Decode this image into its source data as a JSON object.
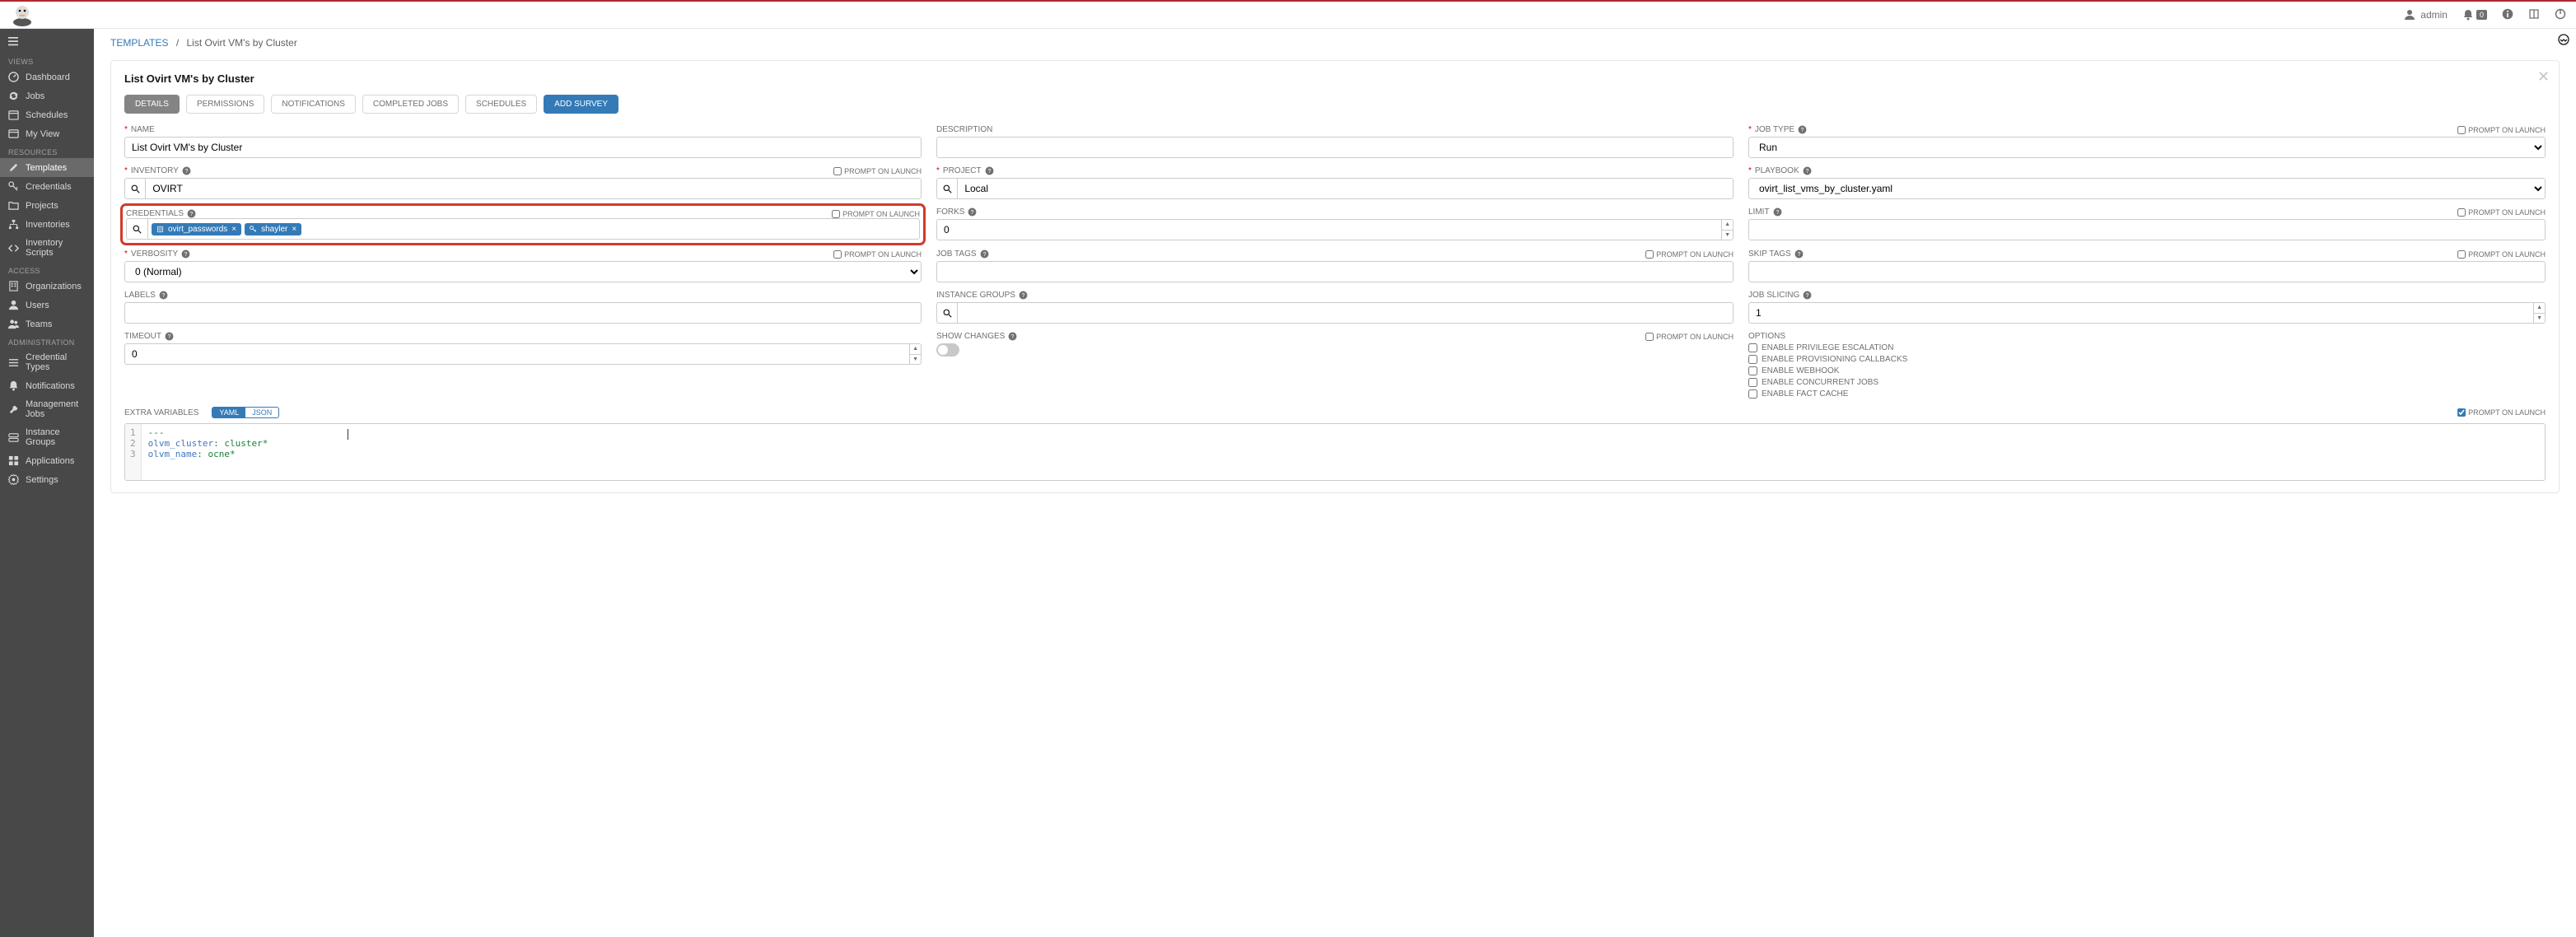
{
  "topbar": {
    "user_label": "admin",
    "notif_count": "0"
  },
  "breadcrumb": {
    "root": "TEMPLATES",
    "current": "List Ovirt VM's by Cluster"
  },
  "panel": {
    "title": "List Ovirt VM's by Cluster"
  },
  "tabs": {
    "details": "DETAILS",
    "permissions": "PERMISSIONS",
    "notifications": "NOTIFICATIONS",
    "completed_jobs": "COMPLETED JOBS",
    "schedules": "SCHEDULES",
    "add_survey": "ADD SURVEY"
  },
  "sidebar": {
    "views": "VIEWS",
    "dashboard": "Dashboard",
    "jobs": "Jobs",
    "schedules": "Schedules",
    "my_view": "My View",
    "resources": "RESOURCES",
    "templates": "Templates",
    "credentials": "Credentials",
    "projects": "Projects",
    "inventories": "Inventories",
    "inventory_scripts": "Inventory Scripts",
    "access": "ACCESS",
    "organizations": "Organizations",
    "users": "Users",
    "teams": "Teams",
    "administration": "ADMINISTRATION",
    "credential_types": "Credential Types",
    "notifications": "Notifications",
    "management_jobs": "Management Jobs",
    "instance_groups": "Instance Groups",
    "applications": "Applications",
    "settings": "Settings"
  },
  "labels": {
    "name": "NAME",
    "description": "DESCRIPTION",
    "job_type": "JOB TYPE",
    "inventory": "INVENTORY",
    "project": "PROJECT",
    "playbook": "PLAYBOOK",
    "credentials": "CREDENTIALS",
    "forks": "FORKS",
    "limit": "LIMIT",
    "verbosity": "VERBOSITY",
    "job_tags": "JOB TAGS",
    "skip_tags": "SKIP TAGS",
    "labels_l": "LABELS",
    "instance_groups": "INSTANCE GROUPS",
    "job_slicing": "JOB SLICING",
    "timeout": "TIMEOUT",
    "show_changes": "SHOW CHANGES",
    "options": "OPTIONS",
    "extra_vars": "EXTRA VARIABLES",
    "prompt": "PROMPT ON LAUNCH",
    "yaml": "YAML",
    "json": "JSON"
  },
  "values": {
    "name": "List Ovirt VM's by Cluster",
    "description": "",
    "job_type": "Run",
    "inventory": "OVIRT",
    "project": "Local",
    "playbook": "ovirt_list_vms_by_cluster.yaml",
    "forks": "0",
    "limit": "",
    "verbosity": "0 (Normal)",
    "job_slicing": "1",
    "timeout": "0",
    "credentials": [
      {
        "name": "ovirt_passwords",
        "icon": "vault"
      },
      {
        "name": "shayler",
        "icon": "key"
      }
    ]
  },
  "options": {
    "priv_esc": "ENABLE PRIVILEGE ESCALATION",
    "prov_cb": "ENABLE PROVISIONING CALLBACKS",
    "webhook": "ENABLE WEBHOOK",
    "concurrent": "ENABLE CONCURRENT JOBS",
    "fact_cache": "ENABLE FACT CACHE"
  },
  "extra_vars": {
    "lines": [
      "1",
      "2",
      "3"
    ],
    "code": "---\nolvm_cluster: cluster*\nolvm_name: ocne*"
  },
  "prompt_checked": {
    "extra_vars": true
  }
}
